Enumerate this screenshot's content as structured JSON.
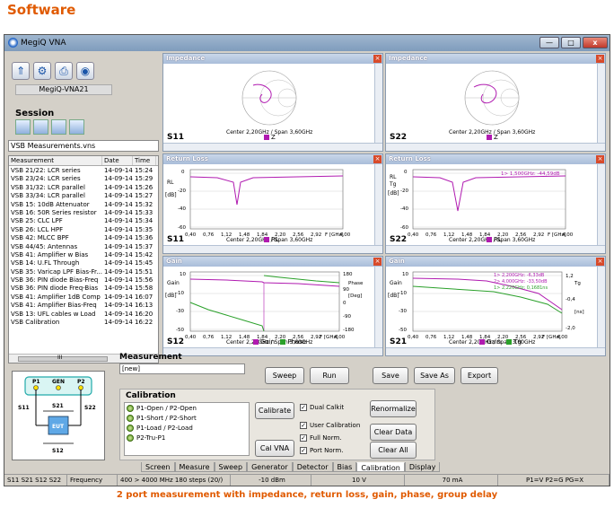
{
  "heading": "Software",
  "window": {
    "title": "MegiQ VNA",
    "minimize": "—",
    "maximize": "□",
    "close": "x"
  },
  "toolbar": {
    "device_name": "MegiQ-VNA21"
  },
  "session": {
    "title": "Session",
    "file": "VSB Measurements.vns"
  },
  "measurements_list": {
    "headers": [
      "Measurement",
      "Date",
      "Time"
    ],
    "rows": [
      [
        "VSB 21/22: LCR series",
        "14-09-14",
        "15:24"
      ],
      [
        "VSB 23/24: LCR series",
        "14-09-14",
        "15:29"
      ],
      [
        "VSB 31/32: LCR parallel",
        "14-09-14",
        "15:26"
      ],
      [
        "VSB 33/34: LCR parallel",
        "14-09-14",
        "15:27"
      ],
      [
        "VSB 15: 10dB Attenuator",
        "14-09-14",
        "15:32"
      ],
      [
        "VSB 16: 50R Series resistor",
        "14-09-14",
        "15:33"
      ],
      [
        "VSB 25: CLC LPF",
        "14-09-14",
        "15:34"
      ],
      [
        "VSB 26: LCL HPF",
        "14-09-14",
        "15:35"
      ],
      [
        "VSB 42: MLCC BPF",
        "14-09-14",
        "15:36"
      ],
      [
        "VSB 44/45: Antennas",
        "14-09-14",
        "15:37"
      ],
      [
        "VSB 41: Amplifier w Bias",
        "14-09-14",
        "15:42"
      ],
      [
        "VSB 14: U.FL Through",
        "14-09-14",
        "15:45"
      ],
      [
        "VSB 35: Varicap LPF Bias-Fr...",
        "14-09-14",
        "15:51"
      ],
      [
        "VSB 36: PIN diode Bias-Freq",
        "14-09-14",
        "15:56"
      ],
      [
        "VSB 36: PIN diode Freq-Bias",
        "14-09-14",
        "15:58"
      ],
      [
        "VSB 41: Amplifier 1dB Comp",
        "14-09-14",
        "16:07"
      ],
      [
        "VSB 41: Amplifier Bias-Freq",
        "14-09-14",
        "16:13"
      ],
      [
        "VSB 13: UFL cables w Load",
        "14-09-14",
        "16:20"
      ],
      [
        "VSB Calibration",
        "14-09-14",
        "16:22"
      ]
    ],
    "scroll_label": "III"
  },
  "diagram": {
    "p1": "P1",
    "gen": "GEN",
    "p2": "P2",
    "s11": "S11",
    "s21": "S21",
    "s22": "S22",
    "s12": "S12",
    "eut": "EUT"
  },
  "panes": {
    "impedance_left": {
      "title": "Impedance",
      "param": "S11",
      "center": "Center 2,20GHz / Span 3,60GHz",
      "legend": "Z",
      "page": "1",
      "side": "1"
    },
    "impedance_right": {
      "title": "Impedance",
      "param": "S22",
      "center": "Center 2,20GHz / Span 3,60GHz",
      "legend": "Z",
      "page": "1"
    },
    "rl_left": {
      "title": "Return Loss",
      "param": "S11",
      "center": "Center 2,20GHz / Span 3,60GHz",
      "legend": "RL",
      "page": "1",
      "side": "0,5",
      "ylabel": "RL",
      "yunit": "[dB]",
      "xunit": "F [GHz]",
      "yticks": [
        "0",
        "-20",
        "-40",
        "-60"
      ],
      "xticks": [
        "0,40",
        "0,76",
        "1,12",
        "1,48",
        "1,84",
        "2,20",
        "2,56",
        "2,92",
        "4,00"
      ]
    },
    "rl_right": {
      "title": "Return Loss",
      "param": "S22",
      "center": "Center 2,20GHz / Span 3,60GHz",
      "legend": "RL",
      "page": "1",
      "side": "0,5",
      "ylabel": "RL",
      "ylabel2": "Tg",
      "yunit": "[dB]",
      "xunit": "F [GHz]",
      "marker": "1> 1,500GHz: -44,59dB",
      "yticks": [
        "0",
        "-20",
        "-40",
        "-60"
      ],
      "xticks": [
        "0,40",
        "0,76",
        "1,12",
        "1,48",
        "1,84",
        "2,20",
        "2,56",
        "2,92",
        "4,00"
      ]
    },
    "gain_left": {
      "title": "Gain",
      "param": "S12",
      "center": "Center 2,20GHz / Span 3,60GHz",
      "legend1": "Gain",
      "legend2": "Phase",
      "page": "1",
      "ylabel": "Gain",
      "yunit": "[dB]",
      "ylabel2": "Phase",
      "yunit2": "[Deg]",
      "xunit": "F [GHz]",
      "yticks": [
        "10",
        "-10",
        "-30",
        "-50"
      ],
      "y2ticks": [
        "180",
        "90",
        "0",
        "-90",
        "-180"
      ],
      "xticks": [
        "0,40",
        "0,76",
        "1,12",
        "1,48",
        "1,84",
        "2,20",
        "2,56",
        "2,92",
        "4,00"
      ]
    },
    "gain_right": {
      "title": "Gain",
      "param": "S21",
      "center": "Center 2,20GHz / Span 3,60GHz",
      "legend1": "Gain",
      "legend2": "Tg",
      "page": "1",
      "ylabel": "Gain",
      "yunit": "[dB]",
      "ylabel2": "Tg",
      "yunit2": "[ns]",
      "xunit": "F [GHz]",
      "markers": [
        "1> 2,200GHz: -6,33dB",
        "2> 4,000GHz: -33,50dB",
        "1> 2,220GHz: 0,1681ns"
      ],
      "yticks": [
        "10",
        "-10",
        "-30",
        "-50"
      ],
      "y2ticks": [
        "1,2",
        "-0,4",
        "-2,0"
      ],
      "xticks": [
        "0,40",
        "0,76",
        "1,12",
        "1,48",
        "1,84",
        "2,20",
        "2,56",
        "2,92",
        "4,00"
      ]
    }
  },
  "measurement": {
    "title": "Measurement",
    "name": "[new]",
    "sweep": "Sweep",
    "run": "Run",
    "save": "Save",
    "save_as": "Save As",
    "export": "Export"
  },
  "calibration": {
    "title": "Calibration",
    "items": [
      "P1-Open / P2-Open",
      "P1-Short / P2-Short",
      "P1-Load / P2-Load",
      "P2-Tru-P1"
    ],
    "calibrate": "Calibrate",
    "cal_vna": "Cal VNA",
    "dual_calkit": "Dual Calkit",
    "user_calibration": "User Calibration",
    "full_norm": "Full Norm.",
    "port_norm": "Port Norm.",
    "renormalize": "Renormalize",
    "clear_data": "Clear Data",
    "clear_all": "Clear All"
  },
  "tabs": [
    "Screen",
    "Measure",
    "Sweep",
    "Generator",
    "Detector",
    "Bias",
    "Calibration",
    "Display"
  ],
  "status": [
    "S11 S21 S12 S22",
    "Frequency",
    "400 > 4000 MHz 180 steps (20/)",
    "-10 dBm",
    "10 V",
    "70 mA",
    "P1=V P2=G PG=X"
  ],
  "caption": "2 port measurement with impedance, return loss, gain, phase, group delay",
  "colors": {
    "accent": "#e05a00",
    "trace_magenta": "#b01ab0",
    "trace_green": "#2aa02a"
  }
}
